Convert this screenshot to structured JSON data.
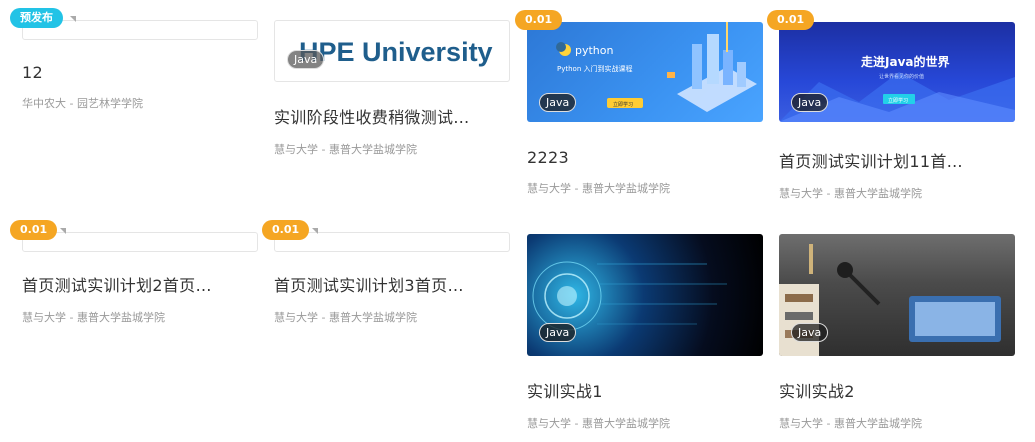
{
  "cards": [
    {
      "badge": "预发布",
      "title": "12",
      "subtitle": "华中农大 - 园艺林学学院"
    },
    {
      "hero_text": "HPE University",
      "lang": "Java",
      "title": "实训阶段性收费稍微测试…",
      "subtitle": "慧与大学 - 惠普大学盐城学院"
    },
    {
      "badge": "0.01",
      "lang": "Java",
      "title": "2223",
      "subtitle": "慧与大学 - 惠普大学盐城学院",
      "hero": {
        "logo": "python",
        "line1": "Python 入门到实战课程",
        "button": "立即学习"
      }
    },
    {
      "badge": "0.01",
      "lang": "Java",
      "title": "首页测试实训计划11首…",
      "subtitle": "慧与大学 - 惠普大学盐城学院",
      "hero": {
        "line1": "走进Java的世界",
        "line2": "让世界看见你的价值",
        "button": "立即学习"
      }
    },
    {
      "badge": "0.01",
      "title": "首页测试实训计划2首页…",
      "subtitle": "慧与大学 - 惠普大学盐城学院"
    },
    {
      "badge": "0.01",
      "title": "首页测试实训计划3首页…",
      "subtitle": "慧与大学 - 惠普大学盐城学院"
    },
    {
      "lang": "Java",
      "title": "实训实战1",
      "subtitle": "慧与大学 - 惠普大学盐城学院"
    },
    {
      "lang": "Java",
      "title": "实训实战2",
      "subtitle": "慧与大学 - 惠普大学盐城学院"
    }
  ],
  "colors": {
    "price_badge": "#f5a623",
    "prerelease_badge": "#22c3e6",
    "title": "#333333",
    "subtitle": "#999999"
  }
}
